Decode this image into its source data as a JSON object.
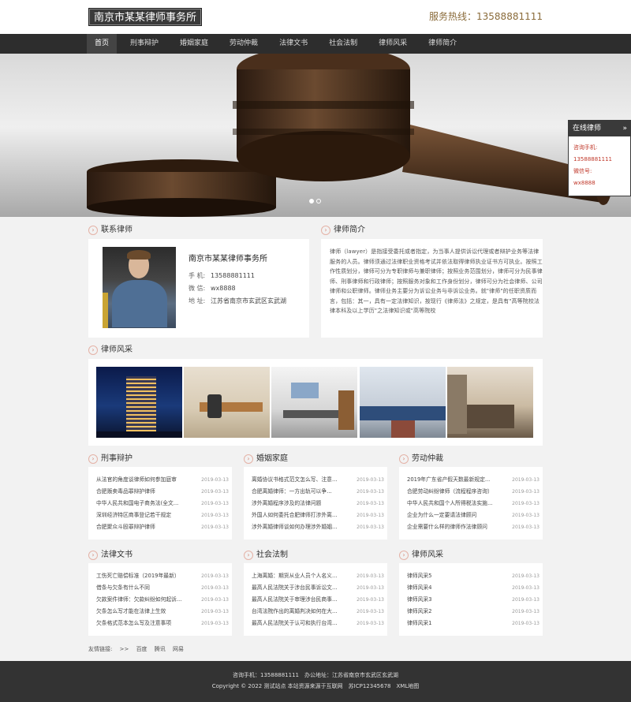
{
  "header": {
    "logo": "南京市某某律师事务所",
    "hotline": "服务热线：13588881111"
  },
  "nav": [
    "首页",
    "刑事辩护",
    "婚姻家庭",
    "劳动仲裁",
    "法律文书",
    "社会法制",
    "律师风采",
    "律师简介"
  ],
  "online": {
    "title": "在线律师",
    "arrow": "»",
    "phone_label": "咨询手机:",
    "phone": "13588881111",
    "wechat_label": "微信号:",
    "wechat": "wx8888"
  },
  "sections": {
    "contact": "联系律师",
    "intro": "律师简介",
    "gallery": "律师风采",
    "criminal": "刑事辩护",
    "marriage": "婚姻家庭",
    "labor": "劳动仲裁",
    "documents": "法律文书",
    "social": "社会法制",
    "style": "律师风采"
  },
  "contact": {
    "name": "南京市某某律师事务所",
    "phone_label": "手 机:",
    "phone": "13588881111",
    "wechat_label": "微 信:",
    "wechat": "wx8888",
    "address_label": "地 址:",
    "address": "江苏省南京市玄武区玄武湖"
  },
  "intro_text": "律师（lawyer）是指接受委托或者指定，为当事人提供诉讼代理或者辩护业务等法律服务的人员。律师须通过法律职业资格考试并依法取得律师执业证书方可执业。按照工作性质划分，律师可分为专职律师与兼职律师；按照业务范围划分，律师可分为民事律师、刑事律师和行政律师；按照服务对象和工作身份划分，律师可分为社会律师、公司律师和公职律师。律师业务主要分为诉讼业务与非诉讼业务。就\"律师\"的任职资质而言，包括：其一，具有一定法律知识，按现行《律师法》之规定，是具有\"高等院校法律本科及以上学历\"之法律知识或\"高等院校",
  "lists": {
    "criminal": [
      {
        "t": "从法官的角度谈律师如何参加庭审",
        "d": "2019-03-13"
      },
      {
        "t": "合肥贩卖毒品罪辩护律师",
        "d": "2019-03-13"
      },
      {
        "t": "中华人民共和国电子商务法(全文...",
        "d": "2019-03-13"
      },
      {
        "t": "深圳经济特区商事登记若干规定",
        "d": "2019-03-13"
      },
      {
        "t": "合肥聚众斗殴罪辩护律师",
        "d": "2019-03-13"
      }
    ],
    "marriage": [
      {
        "t": "离婚协议书格式范文怎么写、注意...",
        "d": "2019-03-13"
      },
      {
        "t": "合肥离婚律师：一方出轨可以争...",
        "d": "2019-03-13"
      },
      {
        "t": "涉外离婚程序涉及的法律问题",
        "d": "2019-03-13"
      },
      {
        "t": "外国人如何委托合肥律师打涉外离...",
        "d": "2019-03-13"
      },
      {
        "t": "涉外离婚律师谈如何办理涉外婚姻...",
        "d": "2019-03-13"
      }
    ],
    "labor": [
      {
        "t": "2019年广东省产假天数最新规定...",
        "d": "2019-03-13"
      },
      {
        "t": "合肥劳动纠纷律师（流程程序咨询）",
        "d": "2019-03-13"
      },
      {
        "t": "中华人民共和国个人所得税法实施...",
        "d": "2019-03-13"
      },
      {
        "t": "企业为什么一定要请法律顾问",
        "d": "2019-03-13"
      },
      {
        "t": "企业需要什么样的律师作法律顾问",
        "d": "2019-03-13"
      }
    ],
    "documents": [
      {
        "t": "工伤死亡赔偿标准（2019年最新）",
        "d": "2019-03-13"
      },
      {
        "t": "借条与欠条有什么不同",
        "d": "2019-03-13"
      },
      {
        "t": "欠款案件律师：欠款纠纷如何起诉...",
        "d": "2019-03-13"
      },
      {
        "t": "欠条怎么写才能在法律上生效",
        "d": "2019-03-13"
      },
      {
        "t": "欠条格式范本怎么写及注意事项",
        "d": "2019-03-13"
      }
    ],
    "social": [
      {
        "t": "上海离婚：期货从业人员个人名义...",
        "d": "2019-03-13"
      },
      {
        "t": "最高人民法院关于涉台民事诉讼文...",
        "d": "2019-03-13"
      },
      {
        "t": "最高人民法院关于审理涉台民商事...",
        "d": "2019-03-13"
      },
      {
        "t": "台湾法院作出的离婚判决如何在大...",
        "d": "2019-03-13"
      },
      {
        "t": "最高人民法院关于认可和执行台湾...",
        "d": "2019-03-13"
      }
    ],
    "style": [
      {
        "t": "律师风采5",
        "d": "2019-03-13"
      },
      {
        "t": "律师风采4",
        "d": "2019-03-13"
      },
      {
        "t": "律师风采3",
        "d": "2019-03-13"
      },
      {
        "t": "律师风采2",
        "d": "2019-03-13"
      },
      {
        "t": "律师风采1",
        "d": "2019-03-13"
      }
    ]
  },
  "links": {
    "label": "友情链接:",
    "arrow": ">>",
    "items": [
      "百度",
      "腾讯",
      "网易"
    ]
  },
  "footer": {
    "line1": "咨询手机：13588881111　办公地址：江苏省南京市玄武区玄武湖",
    "line2": "Copyright © 2022 测试站点 本站资源来源于互联网　苏ICP12345678　XML地图"
  }
}
